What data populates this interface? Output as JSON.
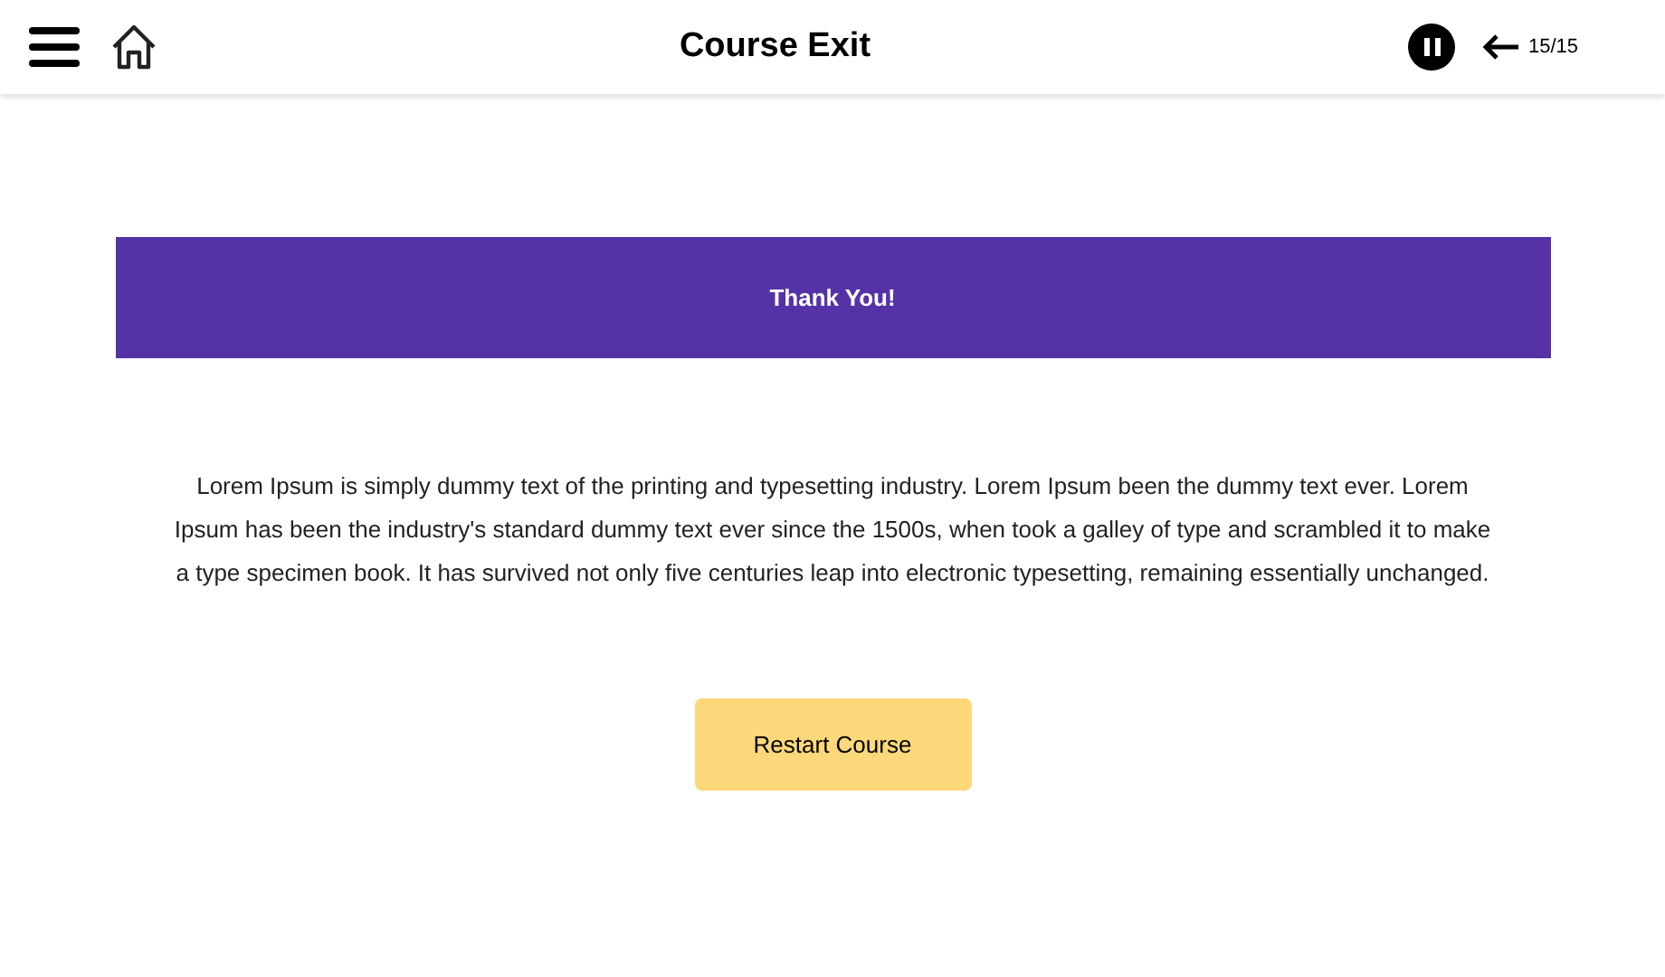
{
  "header": {
    "title": "Course Exit",
    "progress": "15/15"
  },
  "banner": {
    "title": "Thank You!"
  },
  "body": {
    "text": "Lorem Ipsum is simply dummy text of the printing and typesetting industry. Lorem Ipsum been the dummy text ever. Lorem Ipsum has been the industry's standard dummy text ever since the 1500s, when took a galley of type and scrambled it to make a type specimen book. It has survived not only five centuries leap into electronic typesetting, remaining essentially unchanged."
  },
  "buttons": [
    {
      "label": "Restart Course"
    }
  ]
}
